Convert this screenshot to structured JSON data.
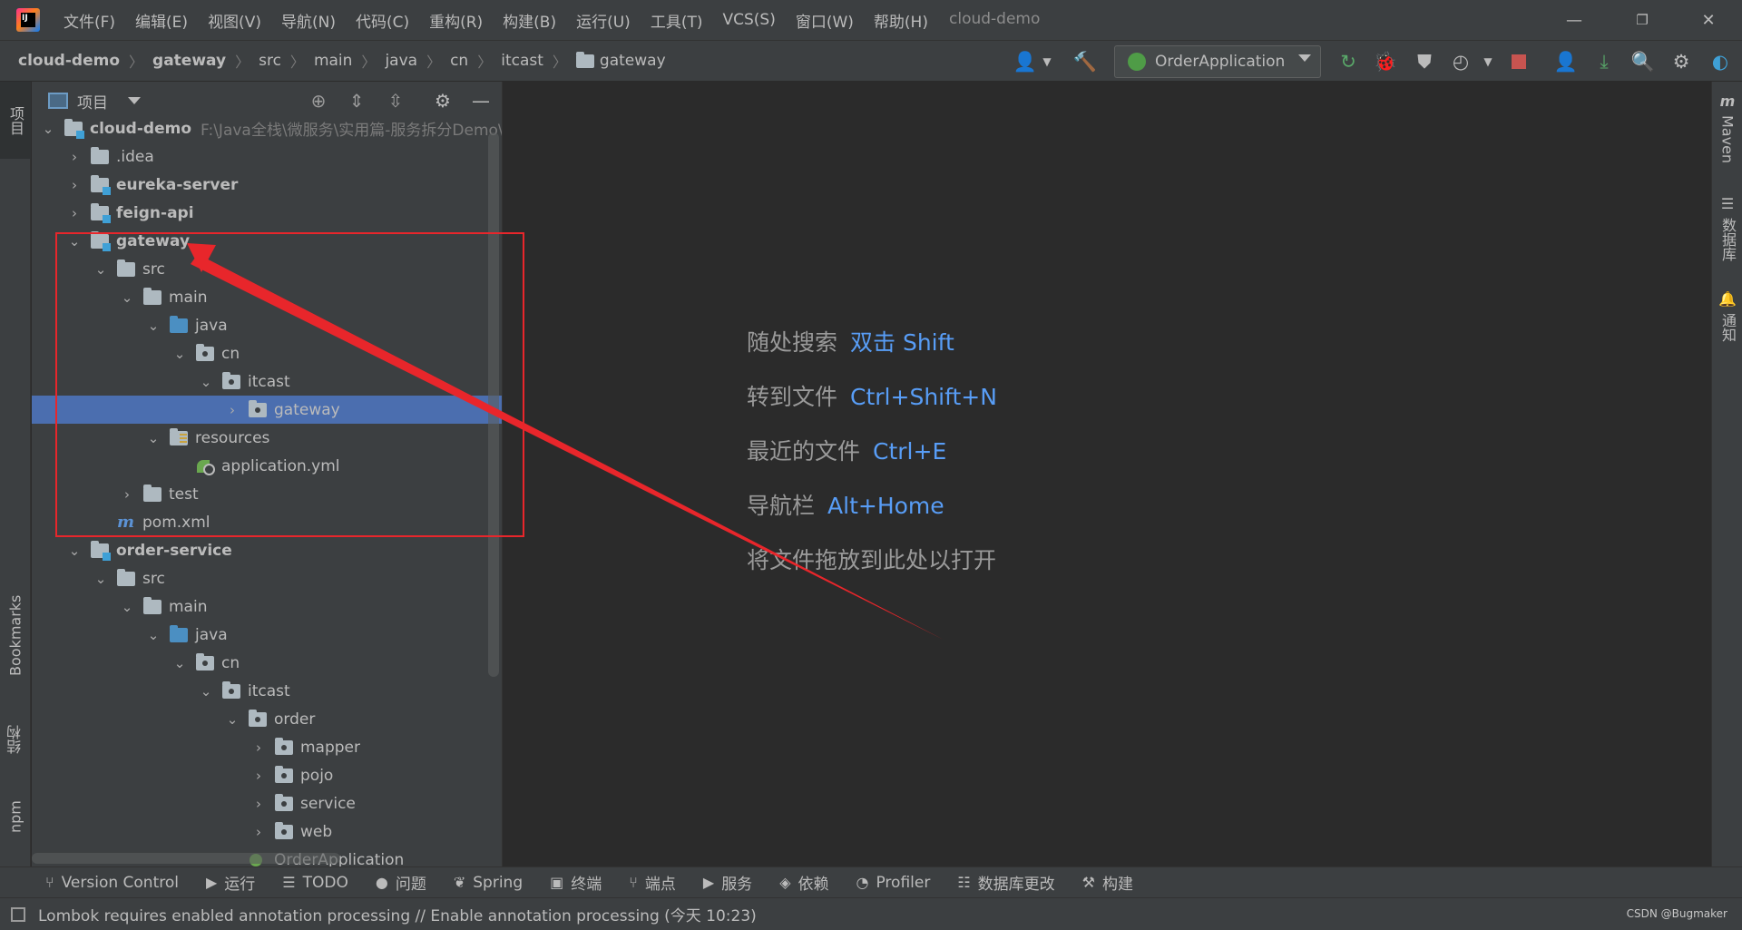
{
  "window": {
    "title": "cloud-demo",
    "minimize_icon": "—",
    "restore_icon": "❐",
    "close_icon": "✕"
  },
  "menu": [
    "文件(F)",
    "编辑(E)",
    "视图(V)",
    "导航(N)",
    "代码(C)",
    "重构(R)",
    "构建(B)",
    "运行(U)",
    "工具(T)",
    "VCS(S)",
    "窗口(W)",
    "帮助(H)"
  ],
  "breadcrumb": [
    "cloud-demo",
    "gateway",
    "src",
    "main",
    "java",
    "cn",
    "itcast",
    "gateway"
  ],
  "run_config": {
    "label": "OrderApplication"
  },
  "project_panel": {
    "title": "项目",
    "tree": [
      {
        "label": "cloud-demo",
        "hint": "F:\\Java全栈\\微服务\\实用篇-服务拆分Demo\\c",
        "icon": "module",
        "chevron": "⌄",
        "bold": true
      },
      {
        "label": ".idea",
        "icon": "folder",
        "chevron": "›",
        "bold": false
      },
      {
        "label": "eureka-server",
        "icon": "module",
        "chevron": "›",
        "bold": true
      },
      {
        "label": "feign-api",
        "icon": "module",
        "chevron": "›",
        "bold": true
      },
      {
        "label": "gateway",
        "icon": "module",
        "chevron": "⌄",
        "bold": true
      },
      {
        "label": "src",
        "icon": "folder",
        "chevron": "⌄",
        "bold": false
      },
      {
        "label": "main",
        "icon": "folder",
        "chevron": "⌄",
        "bold": false
      },
      {
        "label": "java",
        "icon": "src",
        "chevron": "⌄",
        "bold": false
      },
      {
        "label": "cn",
        "icon": "pkg",
        "chevron": "⌄",
        "bold": false
      },
      {
        "label": "itcast",
        "icon": "pkg",
        "chevron": "⌄",
        "bold": false
      },
      {
        "label": "gateway",
        "icon": "pkg",
        "chevron": "›",
        "bold": false,
        "selected": true
      },
      {
        "label": "resources",
        "icon": "res",
        "chevron": "⌄",
        "bold": false
      },
      {
        "label": "application.yml",
        "icon": "yml",
        "chevron": "",
        "bold": false
      },
      {
        "label": "test",
        "icon": "folder",
        "chevron": "›",
        "bold": false
      },
      {
        "label": "pom.xml",
        "icon": "pom",
        "chevron": "",
        "bold": false
      },
      {
        "label": "order-service",
        "icon": "module",
        "chevron": "⌄",
        "bold": true
      },
      {
        "label": "src",
        "icon": "folder",
        "chevron": "⌄",
        "bold": false
      },
      {
        "label": "main",
        "icon": "folder",
        "chevron": "⌄",
        "bold": false
      },
      {
        "label": "java",
        "icon": "src",
        "chevron": "⌄",
        "bold": false
      },
      {
        "label": "cn",
        "icon": "pkg",
        "chevron": "⌄",
        "bold": false
      },
      {
        "label": "itcast",
        "icon": "pkg",
        "chevron": "⌄",
        "bold": false
      },
      {
        "label": "order",
        "icon": "pkg",
        "chevron": "⌄",
        "bold": false
      },
      {
        "label": "mapper",
        "icon": "pkg",
        "chevron": "›",
        "bold": false
      },
      {
        "label": "pojo",
        "icon": "pkg",
        "chevron": "›",
        "bold": false
      },
      {
        "label": "service",
        "icon": "pkg",
        "chevron": "›",
        "bold": false
      },
      {
        "label": "web",
        "icon": "pkg",
        "chevron": "›",
        "bold": false
      },
      {
        "label": "OrderApplication",
        "icon": "spring",
        "chevron": "",
        "bold": false
      }
    ]
  },
  "left_tabs": {
    "project": "项目",
    "bookmarks": "Bookmarks",
    "structure": "结构",
    "npm": "npm"
  },
  "right_tabs": {
    "maven": "Maven",
    "database": "数据库",
    "notifications": "通知"
  },
  "welcome": [
    {
      "text": "随处搜索",
      "key": "双击 Shift"
    },
    {
      "text": "转到文件",
      "key": "Ctrl+Shift+N"
    },
    {
      "text": "最近的文件",
      "key": "Ctrl+E"
    },
    {
      "text": "导航栏",
      "key": "Alt+Home"
    },
    {
      "text": "将文件拖放到此处以打开",
      "key": ""
    }
  ],
  "bottom_tools": [
    {
      "label": "Version Control",
      "icon": "⑂"
    },
    {
      "label": "运行",
      "icon": "▶"
    },
    {
      "label": "TODO",
      "icon": "☰"
    },
    {
      "label": "问题",
      "icon": "●"
    },
    {
      "label": "Spring",
      "icon": "❦"
    },
    {
      "label": "终端",
      "icon": "▣"
    },
    {
      "label": "端点",
      "icon": "⑂"
    },
    {
      "label": "服务",
      "icon": "▶"
    },
    {
      "label": "依赖",
      "icon": "◈"
    },
    {
      "label": "Profiler",
      "icon": "◔"
    },
    {
      "label": "数据库更改",
      "icon": "☷"
    },
    {
      "label": "构建",
      "icon": "⚒"
    }
  ],
  "status": {
    "message": "Lombok requires enabled annotation processing // Enable annotation processing (今天 10:23)",
    "watermark": "CSDN @Bugmaker"
  },
  "colors": {
    "annotation": "#e8262b",
    "selection": "#4b6eaf",
    "shortcut": "#589df6"
  }
}
